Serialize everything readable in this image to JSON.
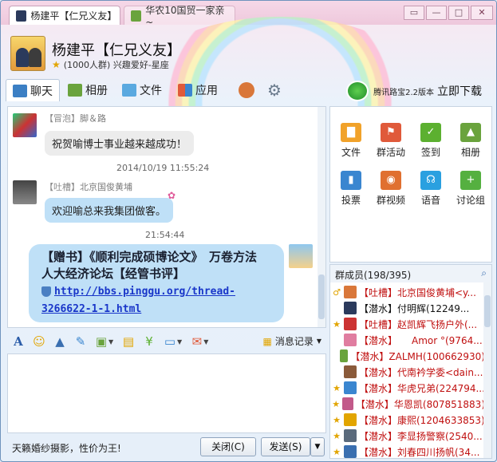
{
  "tabs": [
    {
      "label": "杨建平【仁兄义友】"
    },
    {
      "label": "华农10国贸一家亲~"
    }
  ],
  "window_controls": {
    "restore": "▭",
    "minimize": "—",
    "maximize": "□",
    "close": "✕"
  },
  "header": {
    "group_name": "杨建平【仁兄义友】",
    "group_sub": "(1000人群) 兴趣爱好-星座"
  },
  "toolbar": {
    "chat": "聊天",
    "album": "相册",
    "file": "文件",
    "apps": "应用",
    "download_small": "腾讯路宝2.2版本",
    "download_big": "立即下载"
  },
  "messages": [
    {
      "role": "【冒泡】",
      "sender": "脚＆路",
      "text": "祝贺喻博士事业越来越成功！"
    },
    {
      "timestamp": "2014/10/19 11:55:24"
    },
    {
      "role": "【吐槽】",
      "sender": "北京国俊黄埔",
      "text": "欢迎喻总来我集团做客。"
    },
    {
      "timestamp": "21:54:44"
    },
    {
      "text": "【赠书】《顺利完成硕博论文》　万卷方法 人大经济论坛【经管书评】",
      "link": "http://bbs.pinggu.org/thread-3266622-1-1.html"
    }
  ],
  "format_toolbar": {
    "history": "消息记录"
  },
  "bottom": {
    "ad_text": "天籁婚纱摄影，性价为王!",
    "close_label": "关闭(C)",
    "send_label": "发送(S)",
    "send_arrow": "▼"
  },
  "apps": [
    {
      "label": "文件",
      "color": "#f1a22a"
    },
    {
      "label": "群活动",
      "color": "#e05a3a"
    },
    {
      "label": "签到",
      "color": "#5cb030"
    },
    {
      "label": "相册",
      "color": "#6aa33d"
    },
    {
      "label": "投票",
      "color": "#3a86d0"
    },
    {
      "label": "群视频",
      "color": "#e07030"
    },
    {
      "label": "语音",
      "color": "#2aa0e0"
    },
    {
      "label": "讨论组",
      "color": "#55b040"
    }
  ],
  "members": {
    "header": "群成员(198/395)",
    "list": [
      {
        "text": "【吐槽】北京国俊黄埔<y...",
        "color": "red"
      },
      {
        "text": "【潜水】付明辉(12249...",
        "color": "black"
      },
      {
        "text": "【吐槽】赵凯辉飞扬户外(...",
        "color": "red"
      },
      {
        "text": "【潜水】　　Amor °(9764...",
        "color": "red"
      },
      {
        "text": "【潜水】ZALMH(100662930)",
        "color": "red"
      },
      {
        "text": "【潜水】代南衿学委<dain...",
        "color": "red"
      },
      {
        "text": "【潜水】华虎兄弟(224794...",
        "color": "red"
      },
      {
        "text": "【潜水】华恩凯(807851883)",
        "color": "red"
      },
      {
        "text": "【潜水】康熙(1204633853)",
        "color": "red"
      },
      {
        "text": "【潜水】李显扬警察(2540...",
        "color": "red"
      },
      {
        "text": "【潜水】刘春四川扬帆(34...",
        "color": "red"
      }
    ]
  }
}
